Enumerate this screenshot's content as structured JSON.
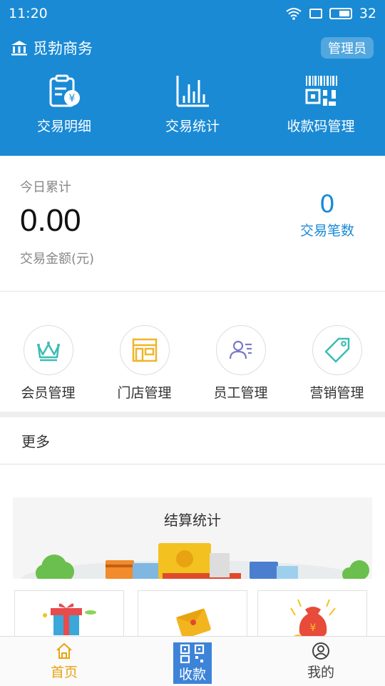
{
  "status_bar": {
    "time": "11:20",
    "battery": "32"
  },
  "header": {
    "brand": "觅勃商务",
    "role_badge": "管理员",
    "nav": [
      {
        "label": "交易明细",
        "icon": "receipt-yen-icon"
      },
      {
        "label": "交易统计",
        "icon": "bar-chart-icon"
      },
      {
        "label": "收款码管理",
        "icon": "qr-code-icon"
      }
    ]
  },
  "summary": {
    "label": "今日累计",
    "amount": "0.00",
    "amount_unit": "交易金额(元)",
    "count": "0",
    "count_label": "交易笔数"
  },
  "grid": [
    {
      "label": "会员管理",
      "icon": "crown-icon"
    },
    {
      "label": "门店管理",
      "icon": "store-icon"
    },
    {
      "label": "员工管理",
      "icon": "staff-icon"
    },
    {
      "label": "营销管理",
      "icon": "tag-icon"
    }
  ],
  "more_label": "更多",
  "banner": {
    "title": "结算统计"
  },
  "tabbar": {
    "home": "首页",
    "collect": "收款",
    "mine": "我的"
  },
  "colors": {
    "primary": "#1a8ad5",
    "active_tab": "#e8a313",
    "collect_button": "#3d84d8"
  }
}
